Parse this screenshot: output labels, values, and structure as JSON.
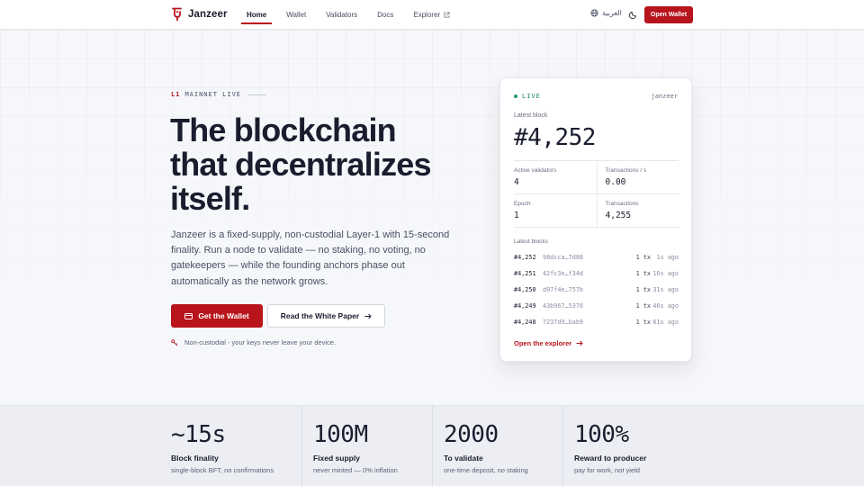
{
  "header": {
    "brand": "Janzeer",
    "nav": [
      {
        "label": "Home",
        "active": true
      },
      {
        "label": "Wallet"
      },
      {
        "label": "Validators"
      },
      {
        "label": "Docs"
      },
      {
        "label": "Explorer",
        "external": true
      }
    ],
    "language": "العربية",
    "cta": "Open Wallet"
  },
  "hero": {
    "eyebrow_tag": "L1",
    "eyebrow_text": "MAINNET LIVE",
    "title_lines": [
      "The blockchain",
      "that decentralizes",
      "itself."
    ],
    "lead": "Janzeer is a fixed-supply, non-custodial Layer-1 with 15-second finality. Run a node to validate — no staking, no voting, no gatekeepers — while the founding anchors phase out automatically as the network grows.",
    "primary_button": "Get the Wallet",
    "secondary_button": "Read the White Paper",
    "note": "Non-custodial - your keys never leave your device."
  },
  "card": {
    "status": "LIVE",
    "brand": "janzeer",
    "latest_block_label": "Latest block",
    "latest_block": "#4,252",
    "stats": [
      {
        "label": "Active validators",
        "value": "4"
      },
      {
        "label": "Transactions / s",
        "value": "0.00"
      },
      {
        "label": "Epoch",
        "value": "1"
      },
      {
        "label": "Transactions",
        "value": "4,255"
      }
    ],
    "latest_blocks_label": "Latest blocks",
    "blocks": [
      {
        "num": "#4,252",
        "hash": "98dcca…7d88",
        "tx": "1 tx",
        "ago": "1s ago"
      },
      {
        "num": "#4,251",
        "hash": "42fc3e…f34d",
        "tx": "1 tx",
        "ago": "16s ago"
      },
      {
        "num": "#4,250",
        "hash": "d07f4e…757b",
        "tx": "1 tx",
        "ago": "31s ago"
      },
      {
        "num": "#4,249",
        "hash": "43b967…5376",
        "tx": "1 tx",
        "ago": "46s ago"
      },
      {
        "num": "#4,248",
        "hash": "7237d9…bab9",
        "tx": "1 tx",
        "ago": "61s ago"
      }
    ],
    "explorer_link": "Open the explorer"
  },
  "metrics": [
    {
      "value": "~15s",
      "label": "Block finality",
      "sub": "single-block BFT, no confirmations"
    },
    {
      "value": "100M",
      "label": "Fixed supply",
      "sub": "never minted — 0% inflation"
    },
    {
      "value": "2000",
      "label": "To validate",
      "sub": "one-time deposit, no staking"
    },
    {
      "value": "100%",
      "label": "Reward to producer",
      "sub": "pay for work, not yield"
    }
  ],
  "colors": {
    "accent": "#b8141c",
    "live": "#1f9d63",
    "text": "#1a1d2e"
  }
}
